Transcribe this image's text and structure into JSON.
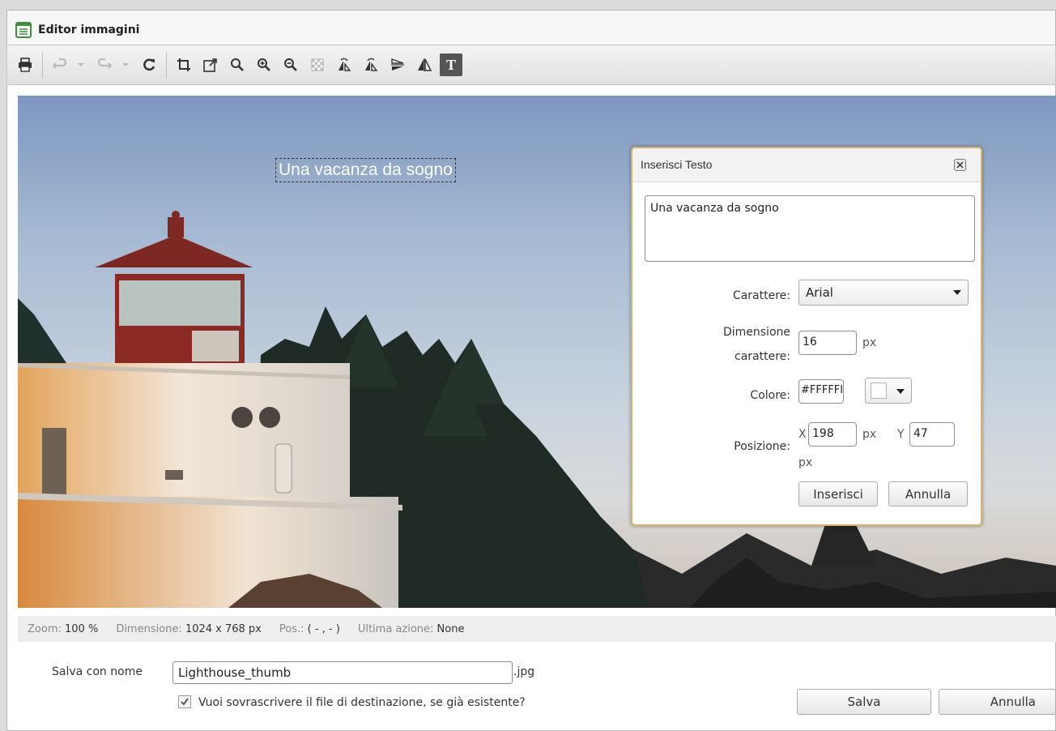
{
  "window": {
    "title": "Editor immagini",
    "icon": "document-list-icon"
  },
  "toolbar": {
    "items": [
      "print-icon",
      "undo-icon",
      "undo-dropdown-icon",
      "redo-icon",
      "redo-dropdown-icon",
      "refresh-icon",
      "crop-icon",
      "resize-icon",
      "zoom-icon",
      "zoom-in-icon",
      "zoom-out-icon",
      "transparency-icon",
      "rotate-left-icon",
      "rotate-right-icon",
      "flip-vertical-icon",
      "flip-horizontal-icon",
      "text-icon"
    ],
    "active": "text-icon"
  },
  "canvas": {
    "overlay_text": "Una vacanza da sogno"
  },
  "status": {
    "zoom_label": "Zoom:",
    "zoom_value": "100 %",
    "dim_label": "Dimensione:",
    "dim_value": "1024 x 768 px",
    "pos_label": "Pos.:",
    "pos_value": "( - , - )",
    "action_label": "Ultima azione:",
    "action_value": "None"
  },
  "save": {
    "label": "Salva con nome",
    "filename": "Lighthouse_thumb",
    "extension": ".jpg",
    "overwrite_label": "Vuoi sovrascrivere il file di destinazione, se già esistente?",
    "overwrite_checked": true,
    "save_button": "Salva",
    "cancel_button": "Annulla"
  },
  "dialog": {
    "title": "Inserisci Testo",
    "text": "Una vacanza da sogno",
    "font_label": "Carattere:",
    "font_value": "Arial",
    "size_label_1": "Dimensione",
    "size_label_2": "carattere:",
    "size_value": "16",
    "size_unit": "px",
    "color_label": "Colore:",
    "color_value": "#FFFFFF",
    "color_display": "#FFFFFI",
    "pos_label": "Posizione:",
    "x_label": "X",
    "x_value": "198",
    "x_unit": "px",
    "y_label": "Y",
    "y_value": "47",
    "y_unit": "px",
    "insert_button": "Inserisci",
    "cancel_button": "Annulla"
  }
}
